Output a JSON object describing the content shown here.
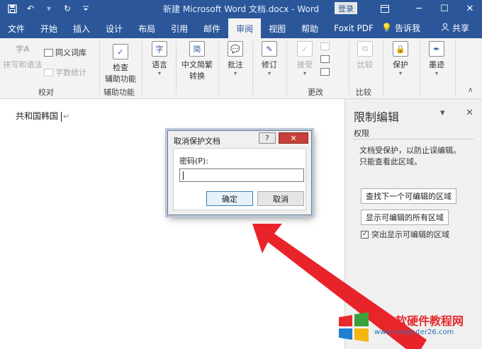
{
  "titlebar": {
    "title": "新建 Microsoft Word 文档.docx - Word",
    "login_label": "登录",
    "qat_icons": [
      "save-icon",
      "undo-icon",
      "redo-icon",
      "customize-icon"
    ]
  },
  "tabs": {
    "items": [
      "文件",
      "开始",
      "插入",
      "设计",
      "布局",
      "引用",
      "邮件",
      "审阅",
      "视图",
      "帮助",
      "Foxit PDF"
    ],
    "active": "审阅",
    "tell_me": "告诉我",
    "share": "共享"
  },
  "ribbon": {
    "proofing": {
      "spelling": "拼写和语法",
      "thesaurus": "同义词库",
      "word_count": "字数统计",
      "label": "校对"
    },
    "accessibility": {
      "check_line1": "检查",
      "check_line2": "辅助功能",
      "label": "辅助功能"
    },
    "language": {
      "label": "语言"
    },
    "chinese_convert": {
      "line1": "中文简繁",
      "line2": "转换"
    },
    "comments": {
      "label": "批注"
    },
    "tracking": {
      "label": "修订"
    },
    "changes": {
      "accept": "接受",
      "label": "更改"
    },
    "compare": {
      "compare": "比较",
      "label": "比较"
    },
    "protect": {
      "label": "保护"
    },
    "ink": {
      "label": "墨迹"
    }
  },
  "document": {
    "text": "共和国韩国",
    "para_mark": "↵"
  },
  "pane": {
    "title": "限制编辑",
    "subtitle": "权限",
    "info_line1": "文档受保护，以防止误编辑。",
    "info_line2": "只能查看此区域。",
    "find_next": "查找下一个可编辑的区域",
    "show_all": "显示可编辑的所有区域",
    "highlight": "突出显示可编辑的区域",
    "highlight_checked": true
  },
  "dialog": {
    "title": "取消保护文档",
    "help": "?",
    "close": "✕",
    "password_label": "密码(P):",
    "password_value": "",
    "ok": "确定",
    "cancel": "取消"
  },
  "watermark": {
    "name": "电脑软硬件教程网",
    "url": "www.computer26.com"
  },
  "colors": {
    "accent": "#2b579a",
    "arrow": "#e8242a",
    "close_red": "#c7403a"
  }
}
